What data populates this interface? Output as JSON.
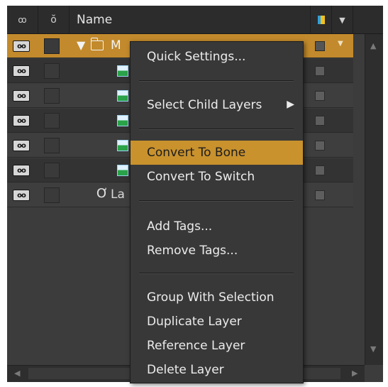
{
  "header": {
    "eye_icon": "eye-icon",
    "lock_icon": "stopwatch-icon",
    "name_label": "Name",
    "color_icon": "label-color-icon",
    "dropdown_icon": "chevron-down-icon"
  },
  "rows": [
    {
      "type": "folder",
      "label": "M",
      "eye_text": "oo",
      "selected": true
    },
    {
      "type": "image",
      "eye_text": "oo"
    },
    {
      "type": "image",
      "eye_text": "oo"
    },
    {
      "type": "image",
      "eye_text": "oo"
    },
    {
      "type": "image",
      "eye_text": "oo"
    },
    {
      "type": "image",
      "eye_text": "oo"
    },
    {
      "type": "curve",
      "label": "La",
      "eye_text": "oo"
    }
  ],
  "menu": {
    "quick_settings": "Quick Settings...",
    "select_child_layers": "Select Child Layers",
    "convert_to_bone": "Convert To Bone",
    "convert_to_switch": "Convert To Switch",
    "add_tags": "Add Tags...",
    "remove_tags": "Remove Tags...",
    "group_with_selection": "Group With Selection",
    "duplicate_layer": "Duplicate Layer",
    "reference_layer": "Reference Layer",
    "delete_layer": "Delete Layer",
    "highlighted_item": "Convert To Bone"
  },
  "colors": {
    "selection": "#c28a2c",
    "menu_highlight": "#c9922d",
    "panel_bg": "#3c3c3c"
  }
}
